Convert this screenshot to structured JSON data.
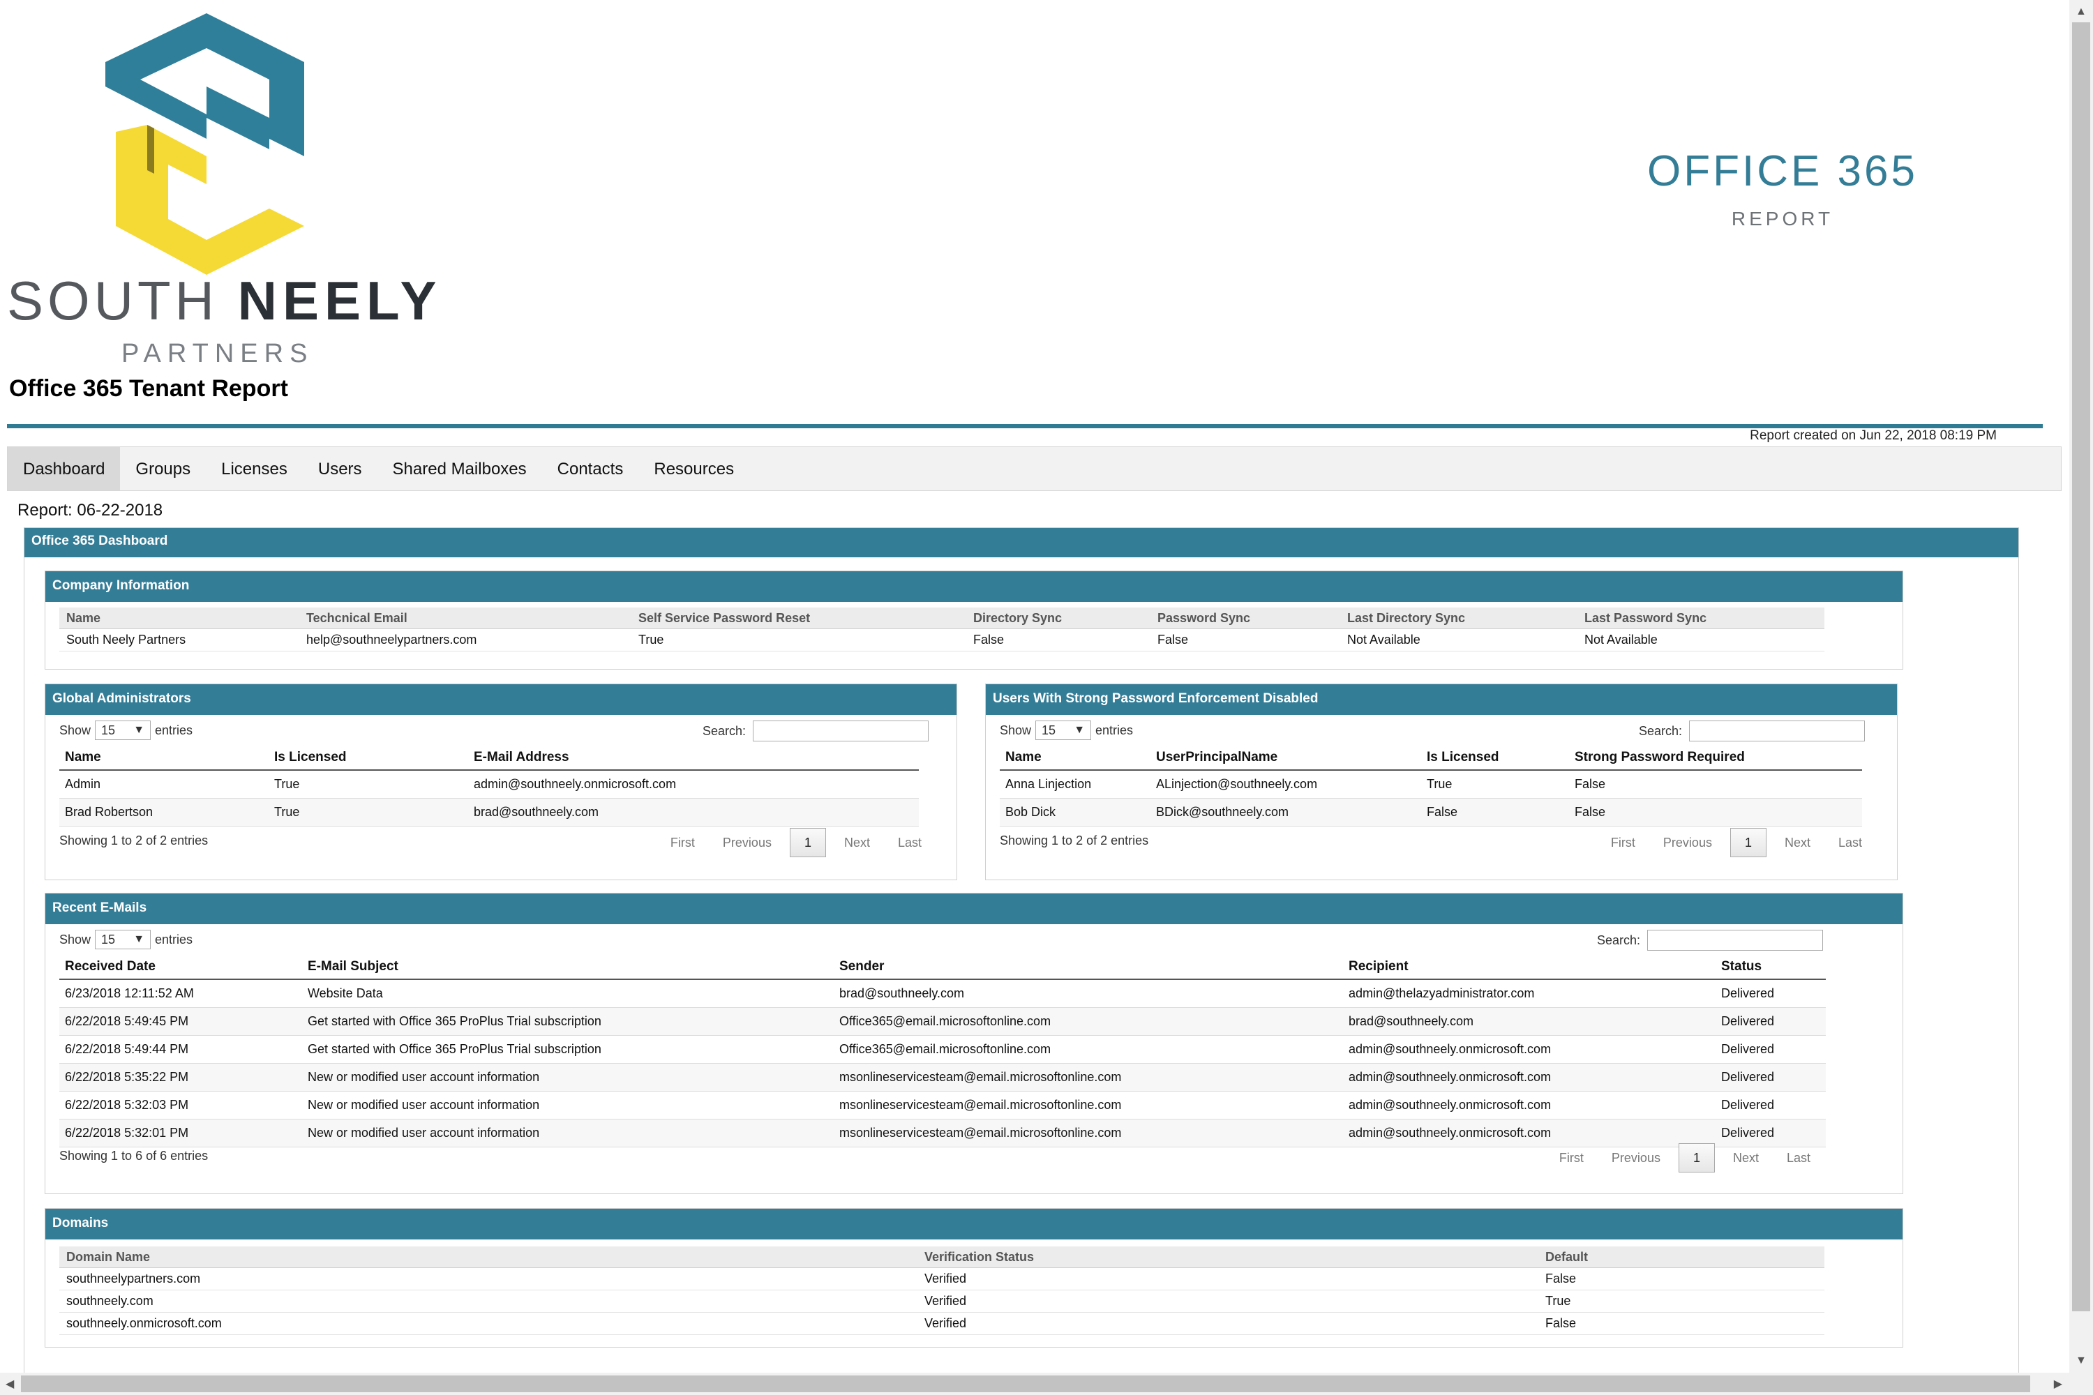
{
  "header": {
    "brand_name_1": "SOUTH",
    "brand_name_2": "NEELY",
    "brand_sub": "PARTNERS",
    "page_title": "Office 365 Tenant Report",
    "o365_title": "OFFICE 365",
    "o365_sub": "REPORT",
    "created": "Report created on Jun 22, 2018 08:19 PM"
  },
  "colors": {
    "accent": "#347d97",
    "logo_teal": "#2f7f9a",
    "logo_yellow": "#f5d935"
  },
  "tabs": [
    {
      "label": "Dashboard"
    },
    {
      "label": "Groups"
    },
    {
      "label": "Licenses"
    },
    {
      "label": "Users"
    },
    {
      "label": "Shared Mailboxes"
    },
    {
      "label": "Contacts"
    },
    {
      "label": "Resources"
    }
  ],
  "report_date": "Report: 06-22-2018",
  "dashboard_title": "Office 365 Dashboard",
  "company": {
    "title": "Company Information",
    "headers": [
      "Name",
      "Techcnical Email",
      "Self Service Password Reset",
      "Directory Sync",
      "Password Sync",
      "Last Directory Sync",
      "Last Password Sync"
    ],
    "row": [
      "South Neely Partners",
      "help@southneelypartners.com",
      "True",
      "False",
      "False",
      "Not Available",
      "Not Available"
    ]
  },
  "table_ui": {
    "show": "Show",
    "entries": "entries",
    "page_size": "15",
    "search": "Search:",
    "first": "First",
    "previous": "Previous",
    "current": "1",
    "next": "Next",
    "last": "Last"
  },
  "admins": {
    "title": "Global Administrators",
    "headers": [
      "Name",
      "Is Licensed",
      "E-Mail Address"
    ],
    "rows": [
      [
        "Admin",
        "True",
        "admin@southneely.onmicrosoft.com"
      ],
      [
        "Brad Robertson",
        "True",
        "brad@southneely.com"
      ]
    ],
    "info": "Showing 1 to 2 of 2 entries"
  },
  "strong_pw": {
    "title": "Users With Strong Password Enforcement Disabled",
    "headers": [
      "Name",
      "UserPrincipalName",
      "Is Licensed",
      "Strong Password Required"
    ],
    "rows": [
      [
        "Anna Linjection",
        "ALinjection@southneely.com",
        "True",
        "False"
      ],
      [
        "Bob Dick",
        "BDick@southneely.com",
        "False",
        "False"
      ]
    ],
    "info": "Showing 1 to 2 of 2 entries"
  },
  "emails": {
    "title": "Recent E-Mails",
    "headers": [
      "Received Date",
      "E-Mail Subject",
      "Sender",
      "Recipient",
      "Status"
    ],
    "rows": [
      [
        "6/23/2018 12:11:52 AM",
        "Website Data",
        "brad@southneely.com",
        "admin@thelazyadministrator.com",
        "Delivered"
      ],
      [
        "6/22/2018 5:49:45 PM",
        "Get started with Office 365 ProPlus Trial subscription",
        "Office365@email.microsoftonline.com",
        "brad@southneely.com",
        "Delivered"
      ],
      [
        "6/22/2018 5:49:44 PM",
        "Get started with Office 365 ProPlus Trial subscription",
        "Office365@email.microsoftonline.com",
        "admin@southneely.onmicrosoft.com",
        "Delivered"
      ],
      [
        "6/22/2018 5:35:22 PM",
        "New or modified user account information",
        "msonlineservicesteam@email.microsoftonline.com",
        "admin@southneely.onmicrosoft.com",
        "Delivered"
      ],
      [
        "6/22/2018 5:32:03 PM",
        "New or modified user account information",
        "msonlineservicesteam@email.microsoftonline.com",
        "admin@southneely.onmicrosoft.com",
        "Delivered"
      ],
      [
        "6/22/2018 5:32:01 PM",
        "New or modified user account information",
        "msonlineservicesteam@email.microsoftonline.com",
        "admin@southneely.onmicrosoft.com",
        "Delivered"
      ]
    ],
    "info": "Showing 1 to 6 of 6 entries"
  },
  "domains": {
    "title": "Domains",
    "headers": [
      "Domain Name",
      "Verification Status",
      "Default"
    ],
    "rows": [
      [
        "southneelypartners.com",
        "Verified",
        "False"
      ],
      [
        "southneely.com",
        "Verified",
        "True"
      ],
      [
        "southneely.onmicrosoft.com",
        "Verified",
        "False"
      ]
    ]
  },
  "icons": {
    "up": "▲",
    "down": "▼",
    "left": "◀",
    "right": "▶",
    "dropdown": "▼"
  }
}
